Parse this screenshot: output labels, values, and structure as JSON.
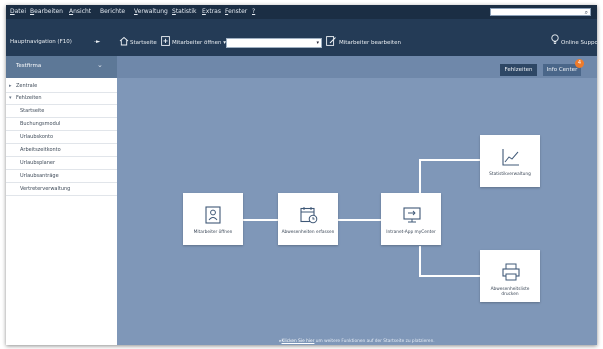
{
  "menubar": {
    "items": [
      {
        "label": "Datei",
        "u": "D",
        "rest": "atei"
      },
      {
        "label": "Bearbeiten",
        "u": "B",
        "rest": "earbeiten"
      },
      {
        "label": "Ansicht",
        "u": "A",
        "rest": "nsicht"
      },
      {
        "label": "Berichte",
        "u": "",
        "rest": "Berichte"
      },
      {
        "label": "Verwaltung",
        "u": "V",
        "rest": "erwaltung"
      },
      {
        "label": "Statistik",
        "u": "S",
        "rest": "tatistik"
      },
      {
        "label": "Extras",
        "u": "E",
        "rest": "xtras"
      },
      {
        "label": "Fenster",
        "u": "F",
        "rest": "enster"
      },
      {
        "label": "?",
        "u": "?",
        "rest": ""
      }
    ]
  },
  "toolbar": {
    "nav_label": "Hauptnavigation (F10)",
    "pin_label": "-►",
    "startseite_label": "Startseite",
    "mitarbeiter_oeffnen_label": "Mitarbeiter öffnen",
    "mitarbeiter_bearbeiten_label": "Mitarbeiter bearbeiten",
    "online_support_label": "Online Support",
    "combo_value": ""
  },
  "sidebar": {
    "header": "Testfirma",
    "groups": [
      {
        "label": "Zentrale",
        "icon": "▸"
      },
      {
        "label": "Fehlzeiten",
        "icon": "▾"
      }
    ],
    "items": [
      "Startseite",
      "Buchungsmodul",
      "Urlaubskonto",
      "Arbeitszeitkonto",
      "Urlaubsplaner",
      "Urlaubsanträge",
      "Vertreterverwaltung"
    ]
  },
  "main": {
    "tabs": {
      "fehlzeiten": "Fehlzeiten",
      "info_center": "Info Center"
    },
    "badge_count": "4",
    "cards": {
      "mitarbeiter": "Mitarbeiter öffnen",
      "abwesenheiten": "Abwesenheiten erfassen",
      "intranet": "Intranet-App myCenter",
      "statistik": "Statistikverwaltung",
      "abwesenheitsliste": "Abwesenheitsliste drucken"
    },
    "footer": {
      "link": "Klicken Sie hier",
      "text": "um weitere Funktionen auf der Startseite zu platzieren."
    }
  },
  "colors": {
    "frame": "#1e3550",
    "main_bg": "#7f97b8",
    "badge": "#ee7b2b"
  }
}
